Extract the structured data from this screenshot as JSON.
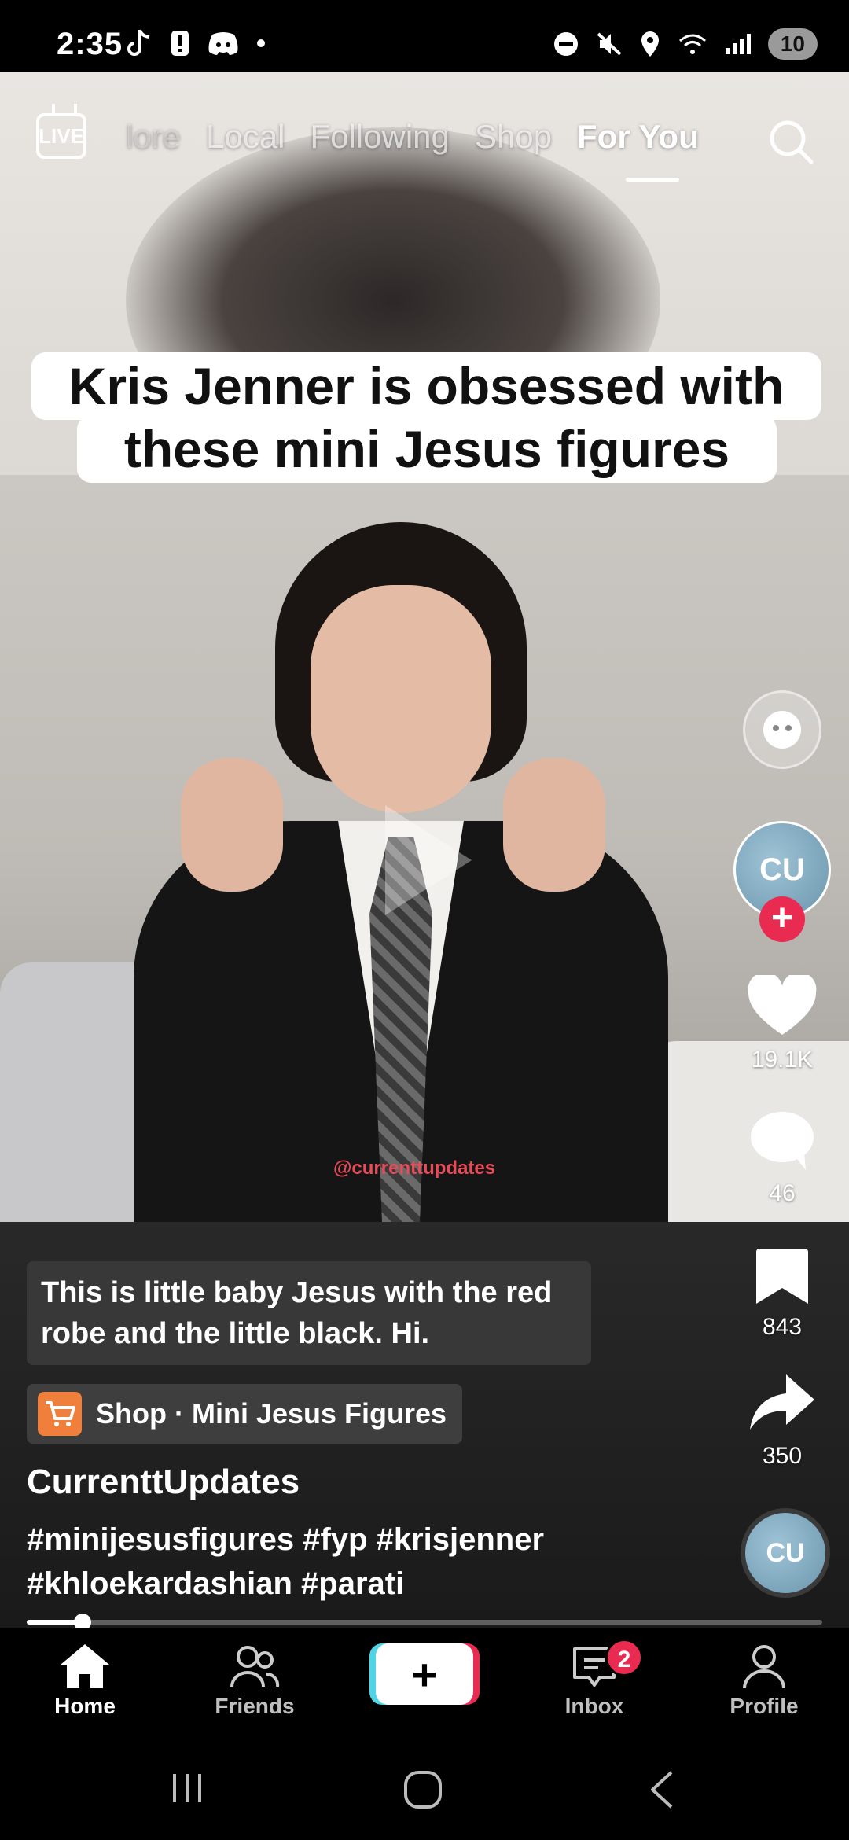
{
  "status_bar": {
    "time": "2:35",
    "battery": "10"
  },
  "top_nav": {
    "live_label": "LIVE",
    "tabs": [
      "lore",
      "Local",
      "Following",
      "Shop",
      "For You"
    ]
  },
  "caption": {
    "line1": "Kris Jenner is obsessed with",
    "line2": "these mini Jesus figures"
  },
  "watermark": "@currenttupdates",
  "right_rail": {
    "avatar_label": "CU",
    "likes": "19.1K",
    "comments": "46",
    "saves": "843",
    "shares": "350"
  },
  "subtitle": "This is little baby Jesus with the red robe and the little black. Hi.",
  "shop": {
    "label": "Shop",
    "separator": "·",
    "product": "Mini Jesus Figures"
  },
  "username": "CurrenttUpdates",
  "hashtags": "#minijesusfigures #fyp #krisjenner #khloekardashian #parati",
  "progress": 0.07,
  "bottom_nav": {
    "home": "Home",
    "friends": "Friends",
    "create": "+",
    "inbox": "Inbox",
    "inbox_badge": "2",
    "profile": "Profile"
  },
  "colors": {
    "accent_red": "#ea2b51",
    "accent_cyan": "#4fd5e6",
    "shop_orange": "#ef7f3a"
  }
}
